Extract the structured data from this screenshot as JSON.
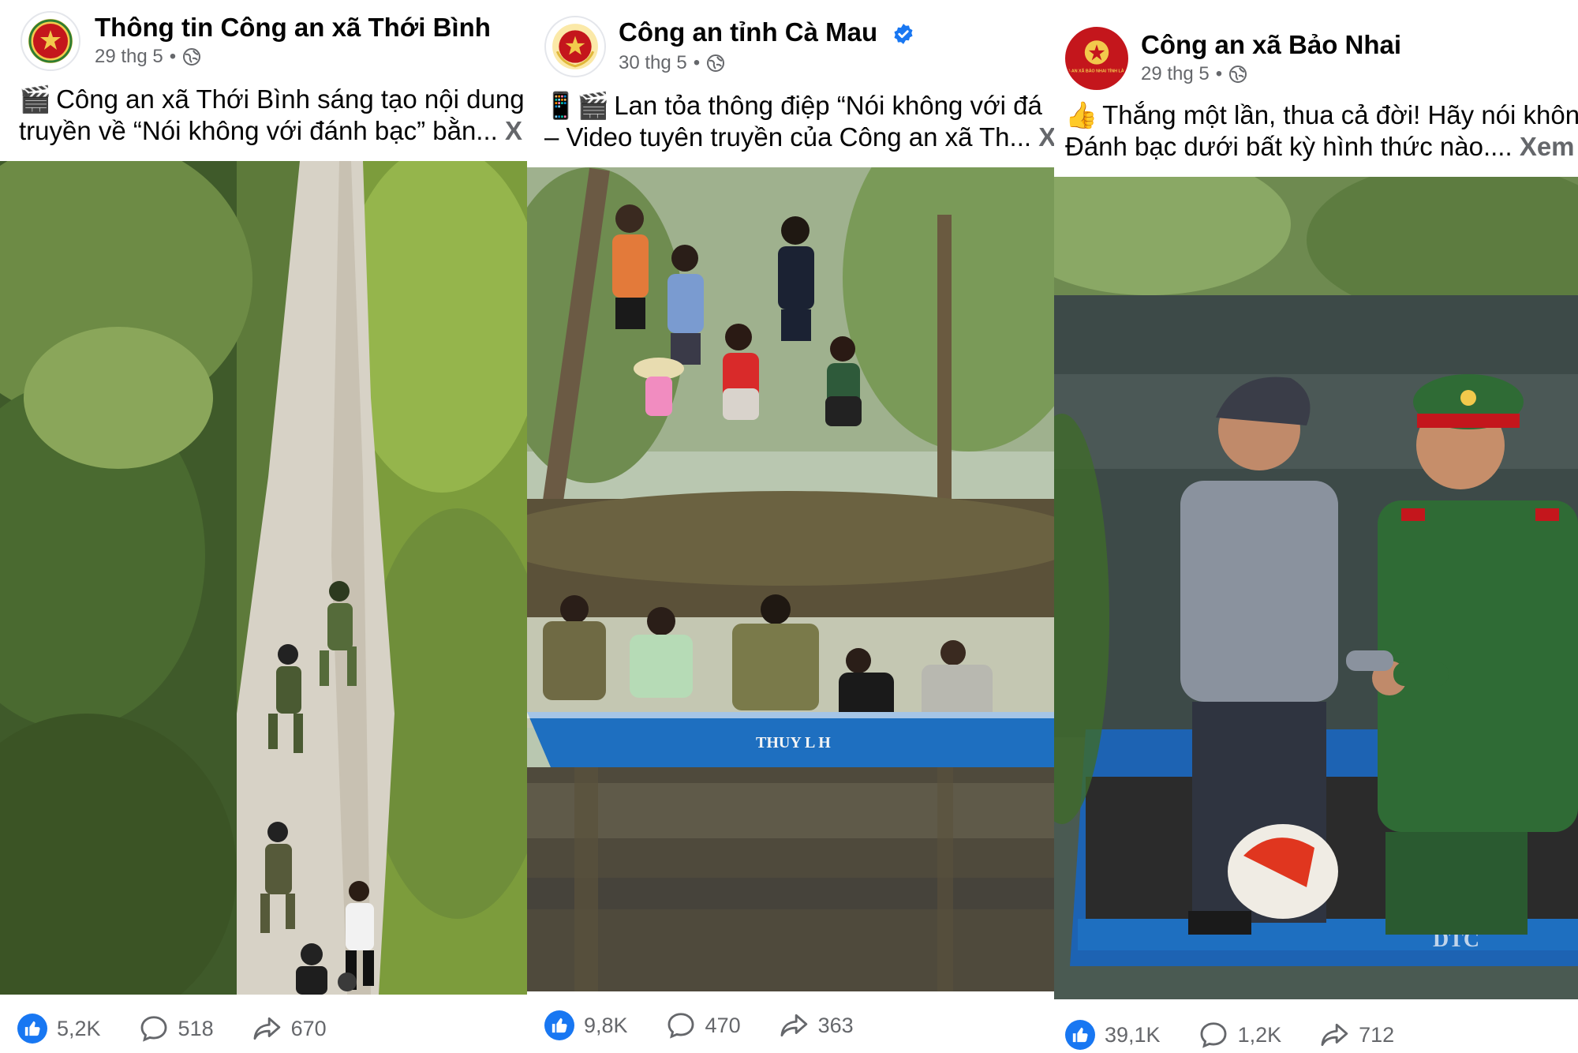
{
  "posts": [
    {
      "author": "Thông tin Công an xã Thới Bình",
      "date": "29 thg 5",
      "verified": false,
      "caption_line1_emoji": "🎬",
      "caption_line1": "Công an xã Thới Bình sáng tạo nội dung",
      "caption_line2": "truyền về “Nói không với đánh bạc” bằn...",
      "see_more": "X",
      "likes": "5,2K",
      "comments": "518",
      "shares": "670",
      "media_icon": "police-chase-scene-image"
    },
    {
      "author": "Công an tỉnh Cà Mau",
      "date": "30 thg 5",
      "verified": true,
      "caption_line1_emoji": "📱🎬",
      "caption_line1": "Lan tỏa thông điệp “Nói không với đá",
      "caption_line2": "– Video tuyên truyền của Công an xã Th...",
      "see_more": "X",
      "boat_label": "THUY L  H",
      "likes": "9,8K",
      "comments": "470",
      "shares": "363",
      "media_icon": "boat-villagers-scene-image"
    },
    {
      "author": "Công an xã Bảo Nhai",
      "date": "29 thg 5",
      "verified": false,
      "caption_line1_emoji": "👍",
      "caption_line1": "Thắng một lần, thua cả đời! Hãy nói khôn",
      "caption_line2": "Đánh bạc dưới bất kỳ hình thức nào....",
      "see_more": "Xem t",
      "avatar_text": "CÔNG AN XÃ BẢO NHAI TỈNH LÀO CAI",
      "likes": "39,1K",
      "comments": "1,2K",
      "shares": "712",
      "media_icon": "officer-boat-scene-image"
    }
  ],
  "colors": {
    "like_blue": "#1877f2",
    "verified_blue": "#1877f2",
    "muted_text": "#65676b",
    "police_red": "#c4161c",
    "police_gold": "#f2c94c"
  }
}
